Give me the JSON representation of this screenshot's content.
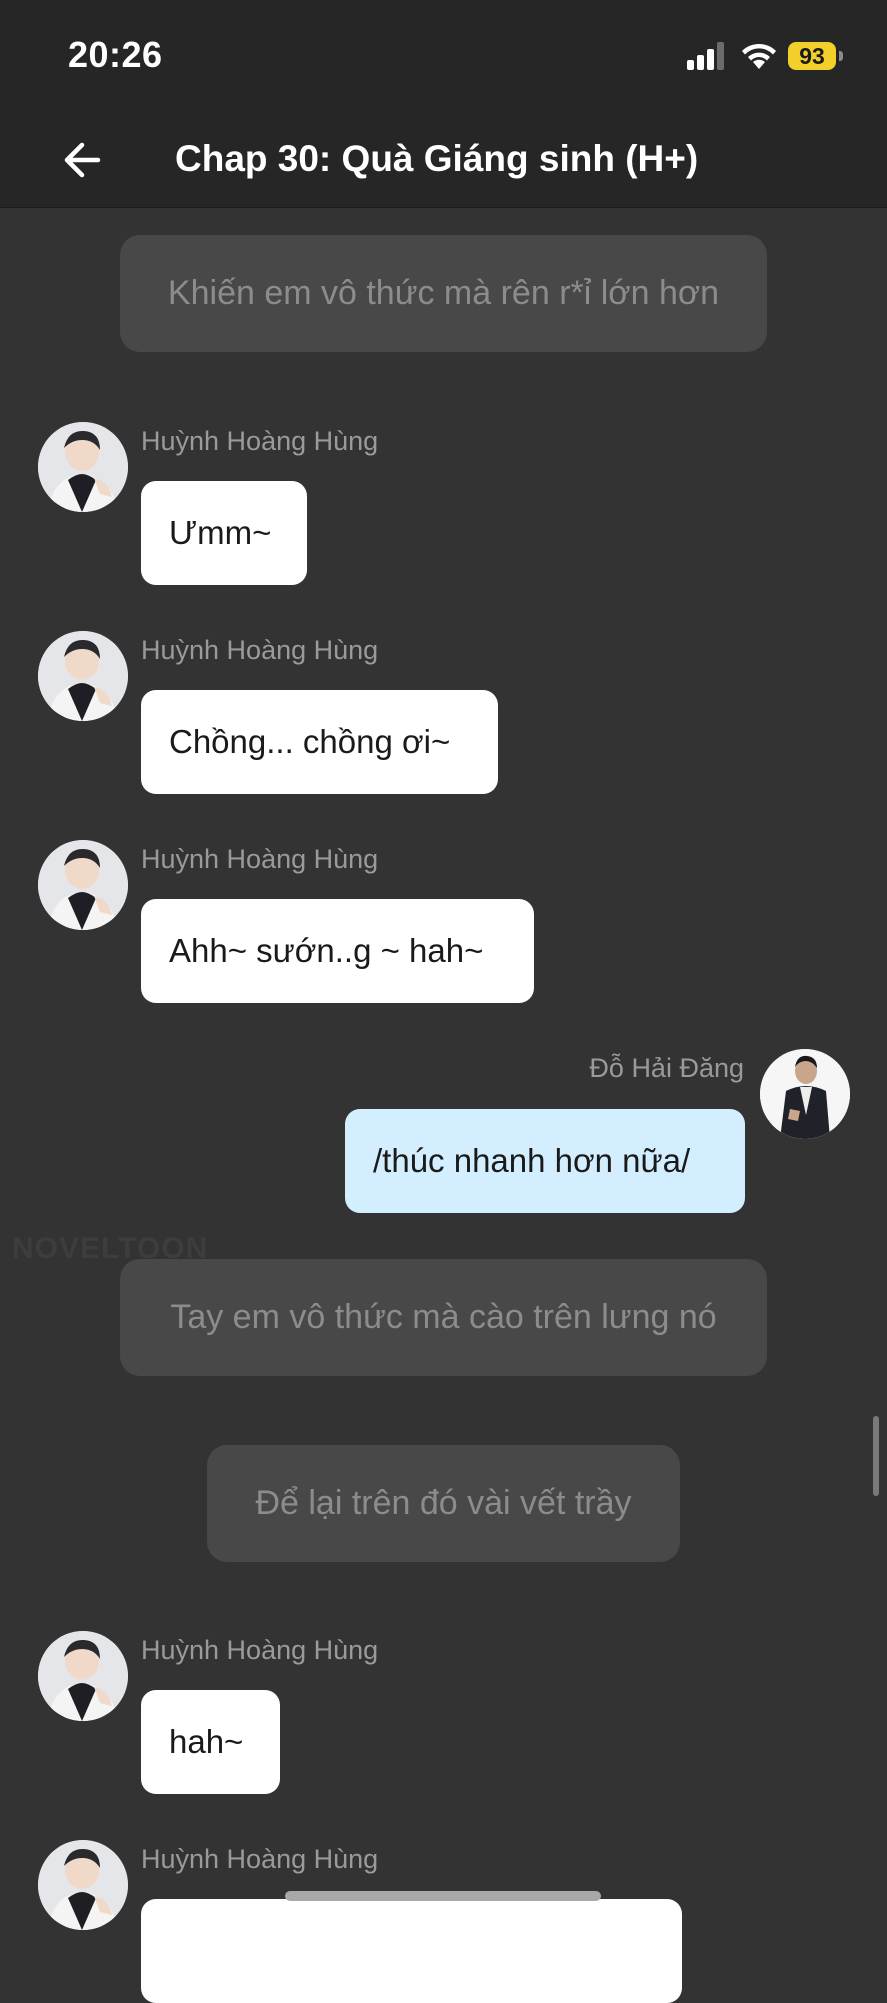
{
  "status_bar": {
    "time": "20:26",
    "battery": "93"
  },
  "header": {
    "title": "Chap 30: Quà Giáng sinh (H+)",
    "back_icon": "arrow-left-icon"
  },
  "messages": [
    {
      "type": "narration",
      "text": "Khiến em vô thức mà rên r*ỉ lớn hơn"
    },
    {
      "type": "message",
      "side": "left",
      "sender": "Huỳnh Hoàng Hùng",
      "text": "Ưmm~"
    },
    {
      "type": "message",
      "side": "left",
      "sender": "Huỳnh Hoàng Hùng",
      "text": "Chồng... chồng ơi~"
    },
    {
      "type": "message",
      "side": "left",
      "sender": "Huỳnh Hoàng Hùng",
      "text": "Ahh~ sướn..g ~ hah~"
    },
    {
      "type": "message",
      "side": "right",
      "sender": "Đỗ Hải Đăng",
      "text": "/thúc nhanh hơn nữa/"
    },
    {
      "type": "narration",
      "text": "Tay em vô thức mà cào trên lưng nó"
    },
    {
      "type": "narration",
      "text": "Để lại trên đó vài vết trầy"
    },
    {
      "type": "message",
      "side": "left",
      "sender": "Huỳnh Hoàng Hùng",
      "text": "hah~"
    },
    {
      "type": "message",
      "side": "left",
      "sender": "Huỳnh Hoàng Hùng",
      "text": ""
    }
  ],
  "watermark": "NOVELTOON",
  "colors": {
    "background": "#333333",
    "header": "#262626",
    "narration_bg": "#484848",
    "bubble_left": "#ffffff",
    "bubble_right": "#d3efff",
    "battery": "#f2cf2b"
  }
}
